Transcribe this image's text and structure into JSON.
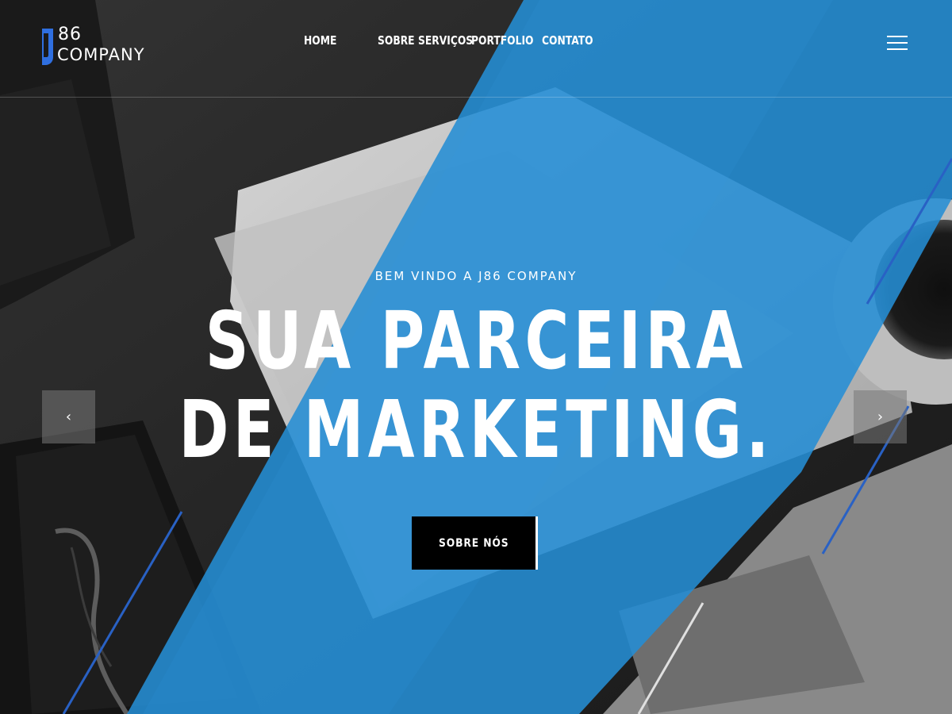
{
  "brand": {
    "number": "86",
    "name": "COMPANY",
    "accent_color": "#2f6fe0",
    "icon": "j-logo-mark"
  },
  "nav": {
    "items": [
      {
        "label": "HOME"
      },
      {
        "label": "SOBRE"
      },
      {
        "label": "SERVIÇOS"
      },
      {
        "label": "PORTFOLIO"
      },
      {
        "label": "CONTATO"
      }
    ],
    "menu_icon": "hamburger-icon"
  },
  "hero": {
    "eyebrow": "BEM VINDO A J86 COMPANY",
    "headline_line1": "SUA PARCEIRA",
    "headline_line2": "DE MARKETING.",
    "cta_label": "SOBRE NÓS",
    "prev_icon": "chevron-left-icon",
    "next_icon": "chevron-right-icon",
    "prev_glyph": "‹",
    "next_glyph": "›",
    "overlay_color": "#2b9fef"
  }
}
